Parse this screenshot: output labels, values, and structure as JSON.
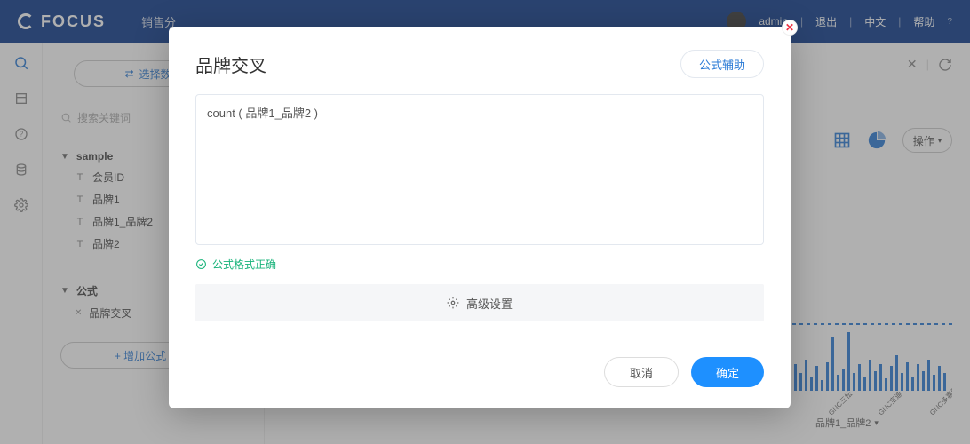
{
  "header": {
    "brand": "FOCUS",
    "tab_sales": "销售分",
    "user_more": "admin",
    "logout": "退出",
    "lang": "中文",
    "help": "帮助"
  },
  "sidebar": {
    "select_data_btn": "选择数据",
    "search_placeholder": "搜索关键词",
    "group_name": "sample",
    "fields": {
      "f0": "会员ID",
      "f1": "品牌1",
      "f2": "品牌1_品牌2",
      "f3": "品牌2"
    },
    "formula_group": "公式",
    "formula_item": "品牌交叉",
    "add_formula": "+  增加公式"
  },
  "main": {
    "axis_label": "品牌1_品牌2",
    "actions_label": "操作",
    "xticks": {
      "t0": "GNC三松",
      "t1": "GNC宝迪",
      "t2": "GNC多喜爱"
    }
  },
  "modal": {
    "title": "品牌交叉",
    "helper": "公式辅助",
    "editor_value": "count ( 品牌1_品牌2 )",
    "status_text": "公式格式正确",
    "advanced": "高级设置",
    "cancel": "取消",
    "ok": "确定"
  }
}
